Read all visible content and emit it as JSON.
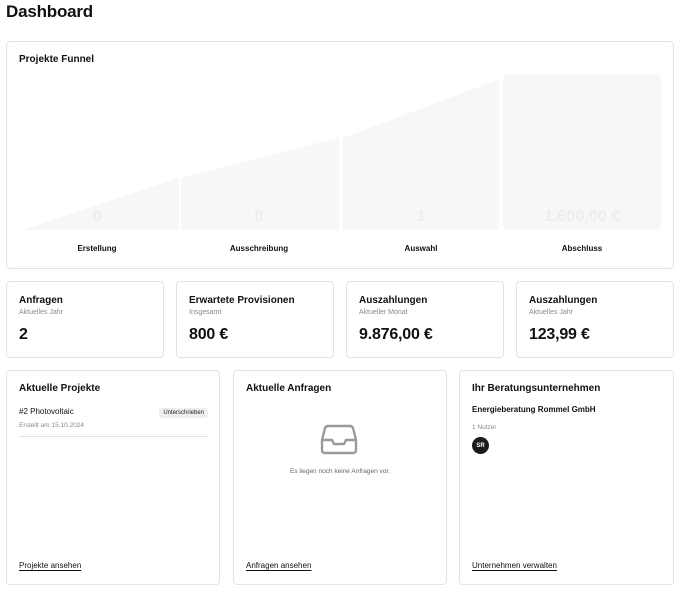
{
  "page": {
    "title": "Dashboard"
  },
  "funnel": {
    "title": "Projekte Funnel",
    "stages": [
      {
        "label": "Erstellung",
        "value": "0"
      },
      {
        "label": "Ausschreibung",
        "value": "0"
      },
      {
        "label": "Auswahl",
        "value": "1"
      },
      {
        "label": "Abschluss",
        "value": "1.600,00 €"
      }
    ]
  },
  "kpis": [
    {
      "title": "Anfragen",
      "subtitle": "Aktuelles Jahr",
      "value": "2"
    },
    {
      "title": "Erwartete Provisionen",
      "subtitle": "Insgesamt",
      "value": "800 €"
    },
    {
      "title": "Auszahlungen",
      "subtitle": "Aktueller Monat",
      "value": "9.876,00 €"
    },
    {
      "title": "Auszahlungen",
      "subtitle": "Aktuelles Jahr",
      "value": "123,99 €"
    }
  ],
  "projects": {
    "title": "Aktuelle Projekte",
    "items": [
      {
        "name": "#2 Photovoltaic",
        "date": "Erstellt am 15.10.2024",
        "status": "Unterschrieben"
      }
    ],
    "link": "Projekte ansehen"
  },
  "requests": {
    "title": "Aktuelle Anfragen",
    "empty_text": "Es liegen noch keine Anfragen vor.",
    "icon": "inbox-icon",
    "link": "Anfragen ansehen"
  },
  "company": {
    "title": "Ihr Beratungsunternehmen",
    "name": "Energieberatung Rommel GmbH",
    "users": "1 Nutzer",
    "avatar_initials": "SR",
    "link": "Unternehmen verwalten"
  }
}
